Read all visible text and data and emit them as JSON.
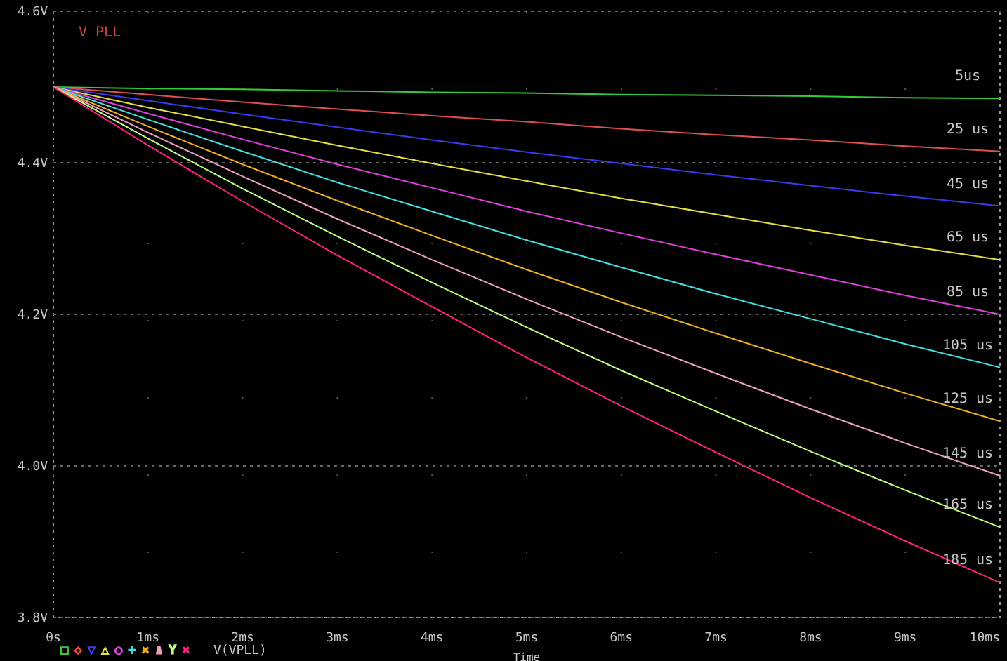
{
  "chart_data": {
    "type": "line",
    "title": "V PLL",
    "xlabel": "Time",
    "x": [
      0,
      1,
      2,
      3,
      4,
      5,
      6,
      7,
      8,
      9,
      10
    ],
    "series": [
      {
        "name": "5us",
        "color": "#33cc33",
        "values": [
          4.5,
          4.498,
          4.497,
          4.495,
          4.493,
          4.492,
          4.49,
          4.489,
          4.488,
          4.486,
          4.485
        ]
      },
      {
        "name": "25 us",
        "color": "#e05050",
        "values": [
          4.5,
          4.49,
          4.48,
          4.471,
          4.462,
          4.454,
          4.445,
          4.437,
          4.43,
          4.422,
          4.415
        ]
      },
      {
        "name": "45 us",
        "color": "#3a3aee",
        "values": [
          4.5,
          4.482,
          4.464,
          4.447,
          4.43,
          4.414,
          4.399,
          4.384,
          4.37,
          4.356,
          4.343
        ]
      },
      {
        "name": "65 us",
        "color": "#e0e040",
        "values": [
          4.5,
          4.473,
          4.448,
          4.423,
          4.399,
          4.376,
          4.353,
          4.332,
          4.311,
          4.291,
          4.272
        ]
      },
      {
        "name": "85 us",
        "color": "#e040e0",
        "values": [
          4.5,
          4.465,
          4.431,
          4.398,
          4.367,
          4.336,
          4.307,
          4.279,
          4.252,
          4.225,
          4.2
        ]
      },
      {
        "name": "105 us",
        "color": "#40e0e0",
        "values": [
          4.5,
          4.457,
          4.415,
          4.374,
          4.336,
          4.298,
          4.262,
          4.227,
          4.194,
          4.161,
          4.13
        ]
      },
      {
        "name": "125 us",
        "color": "#f0b020",
        "values": [
          4.5,
          4.448,
          4.398,
          4.35,
          4.304,
          4.259,
          4.216,
          4.175,
          4.135,
          4.096,
          4.059
        ]
      },
      {
        "name": "145 us",
        "color": "#f0a0c0",
        "values": [
          4.5,
          4.44,
          4.382,
          4.326,
          4.272,
          4.22,
          4.17,
          4.122,
          4.075,
          4.03,
          3.987
        ]
      },
      {
        "name": "165 us",
        "color": "#c0ff80",
        "values": [
          4.5,
          4.432,
          4.366,
          4.303,
          4.242,
          4.183,
          4.126,
          4.072,
          4.019,
          3.968,
          3.919
        ]
      },
      {
        "name": "185 us",
        "color": "#ff2080",
        "values": [
          4.5,
          4.423,
          4.349,
          4.278,
          4.21,
          4.143,
          4.079,
          4.018,
          3.958,
          3.901,
          3.846
        ]
      }
    ],
    "grid": true,
    "xlim": [
      0,
      10
    ],
    "ylim": [
      3.8,
      4.6
    ],
    "xticks": [
      {
        "value": 0,
        "label": "0s"
      },
      {
        "value": 1,
        "label": "1ms"
      },
      {
        "value": 2,
        "label": "2ms"
      },
      {
        "value": 3,
        "label": "3ms"
      },
      {
        "value": 4,
        "label": "4ms"
      },
      {
        "value": 5,
        "label": "5ms"
      },
      {
        "value": 6,
        "label": "6ms"
      },
      {
        "value": 7,
        "label": "7ms"
      },
      {
        "value": 8,
        "label": "8ms"
      },
      {
        "value": 9,
        "label": "9ms"
      },
      {
        "value": 10,
        "label": "10ms"
      }
    ],
    "yticks": [
      {
        "value": 3.8,
        "label": "3.8V"
      },
      {
        "value": 4.0,
        "label": "4.0V"
      },
      {
        "value": 4.2,
        "label": "4.2V"
      },
      {
        "value": 4.4,
        "label": "4.4V"
      },
      {
        "value": 4.6,
        "label": "4.6V"
      }
    ]
  },
  "legend": {
    "markers": [
      {
        "symbol": "□",
        "color": "#33cc33"
      },
      {
        "symbol": "◇",
        "color": "#e05050"
      },
      {
        "symbol": "▽",
        "color": "#3a3aee"
      },
      {
        "symbol": "△",
        "color": "#e0e040"
      },
      {
        "symbol": "○",
        "color": "#e040e0"
      },
      {
        "symbol": "+",
        "color": "#40e0e0"
      },
      {
        "symbol": "×",
        "color": "#f0b020"
      },
      {
        "symbol": "∧",
        "color": "#f0a0c0"
      },
      {
        "symbol": "Y",
        "color": "#c0ff80"
      },
      {
        "symbol": "×",
        "color": "#ff2080"
      }
    ],
    "label": "V(VPLL)"
  }
}
